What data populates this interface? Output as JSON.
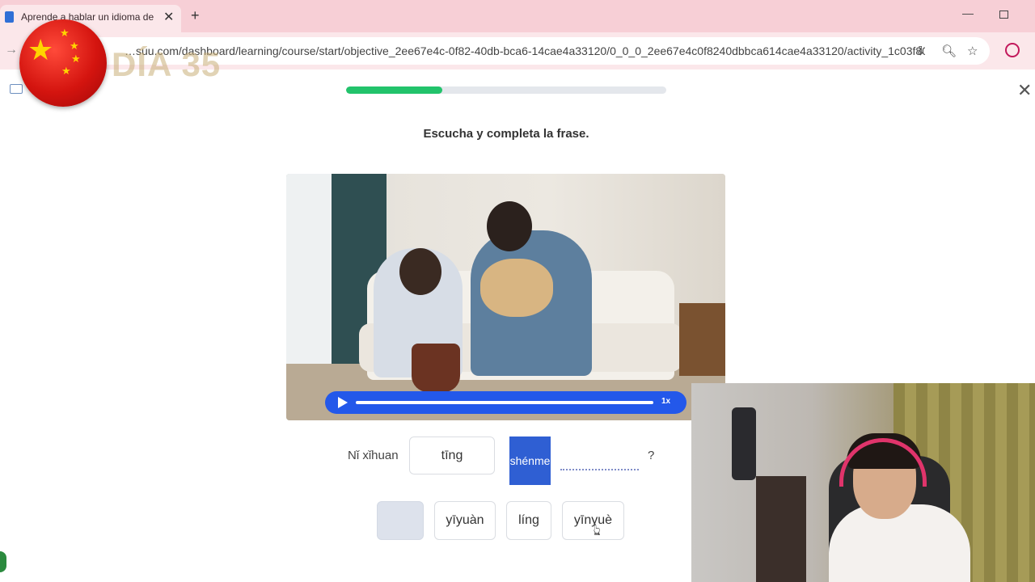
{
  "browser": {
    "tab_title": "Aprende a hablar un idioma de",
    "url": "…suu.com/dashboard/learning/course/start/objective_2ee67e4c-0f82-40db-bca6-14cae4a33120/0_0_0_2ee67e4c0f8240dbbca614cae4a33120/activity_1c03f804-1..."
  },
  "overlay": {
    "day_label": "DÍA 35"
  },
  "lesson": {
    "progress": 0.3,
    "instruction": "Escucha y completa la frase.",
    "audio_speed": "1x",
    "sentence": {
      "prefix": "Nǐ xǐhuan",
      "slot1": "tīng",
      "slot2_selected": "shénme",
      "suffix": "?"
    },
    "options": [
      "",
      "yīyuàn",
      "líng",
      "yīnyuè"
    ]
  },
  "colors": {
    "progress_fill": "#22c36b",
    "accent_blue": "#2358ea",
    "selected_word": "#2f5fd3",
    "chrome_pink": "#f7cfd6"
  }
}
